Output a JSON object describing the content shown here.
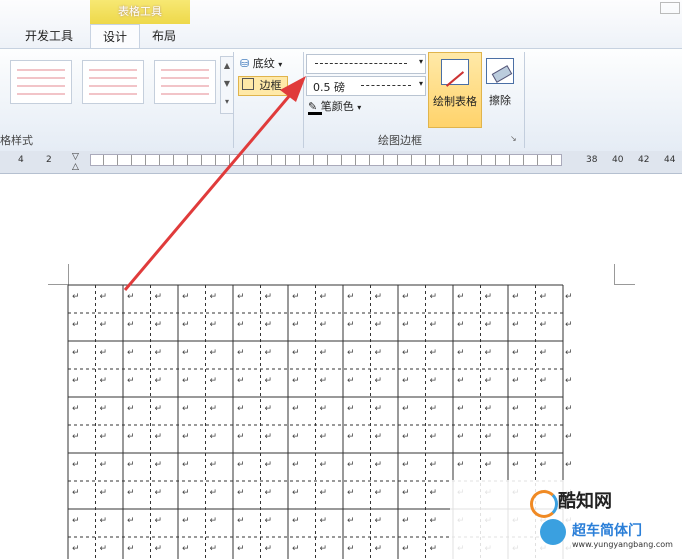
{
  "tabs": {
    "context_header": "表格工具",
    "items": [
      {
        "label": "开发工具",
        "active": false
      },
      {
        "label": "设计",
        "active": true
      },
      {
        "label": "布局",
        "active": false
      }
    ]
  },
  "ribbon": {
    "table_styles_group": "格样式",
    "shading_label": "底纹",
    "borders_label": "边框",
    "line_weight": "0.5 磅",
    "pen_color_label": "笔颜色",
    "draw_table_label": "绘制表格",
    "eraser_label": "擦除",
    "draw_borders_group": "绘图边框"
  },
  "ruler": {
    "left_ticks": [
      "4",
      "2"
    ],
    "right_ticks": [
      "38",
      "40",
      "42",
      "44"
    ]
  },
  "document": {
    "cell_mark": "↵"
  },
  "watermark": {
    "brand": "酷知网",
    "site_name": "超车简体门",
    "site_url": "www.yungyangbang.com"
  },
  "colors": {
    "accent_context": "#eed84a",
    "arrow": "#e03b3b",
    "ribbon_bg": "#e9eff7"
  }
}
